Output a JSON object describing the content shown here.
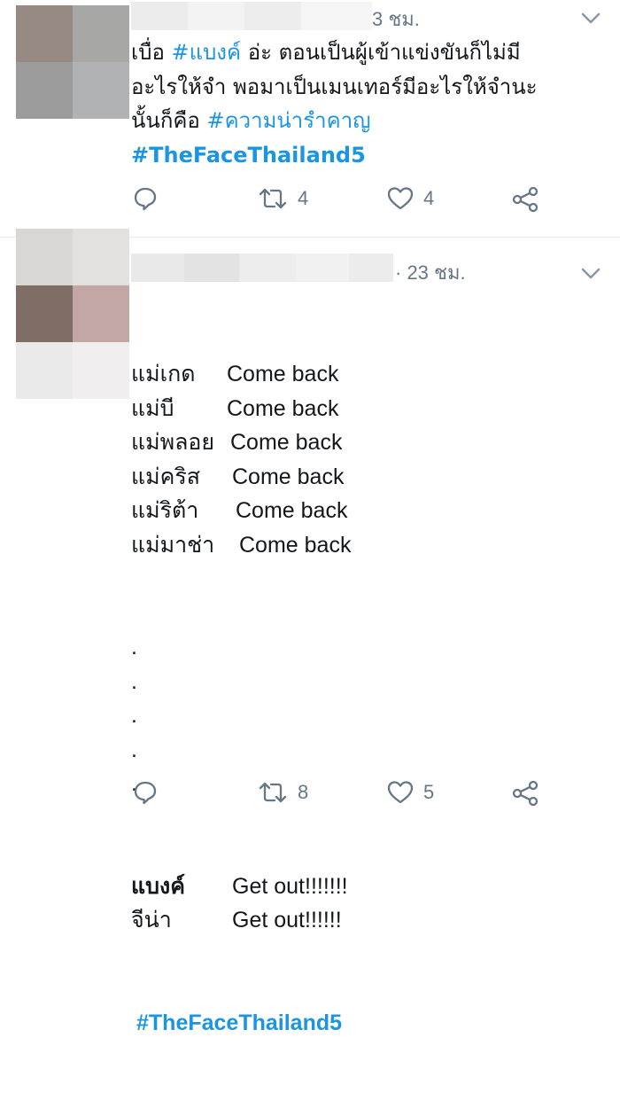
{
  "tweets": [
    {
      "time": "3 ชม.",
      "lines": [
        [
          {
            "t": "เบื่อ "
          },
          {
            "t": "#แบงค์",
            "tag": true
          },
          {
            "t": " อ่ะ ตอนเป็นผู้เข้าแข่งขันก็ไม่มี"
          }
        ],
        [
          {
            "t": "อะไรให้จำ พอมาเป็นเมนเทอร์มีอะไรให้จำนะ"
          }
        ],
        [
          {
            "t": "นั้นก็คือ "
          },
          {
            "t": "#ความน่ารำคาญ",
            "tag": true
          }
        ],
        [
          {
            "t": "#TheFaceThailand5",
            "tag": true,
            "bold": true
          }
        ]
      ],
      "actions": {
        "reply_icon": "reply-icon",
        "retweet_count": "4",
        "like_count": "4",
        "share_icon": "share-icon"
      }
    },
    {
      "time": "· 23 ชม.",
      "rows": [
        {
          "name": "แม่เกด",
          "phrase": "Come back"
        },
        {
          "name": "แม่บี",
          "phrase": "Come back"
        },
        {
          "name": "แม่พลอย",
          "phrase": "Come back"
        },
        {
          "name": "แม่คริส",
          "phrase": "Come back"
        },
        {
          "name": "แม่ริต้า",
          "phrase": "Come back"
        },
        {
          "name": "แม่มาช่า",
          "phrase": "Come back"
        }
      ],
      "dots": [
        ".",
        ".",
        ".",
        ".",
        "."
      ],
      "rows_end": [
        {
          "name": "แบงค์",
          "phrase": "Get out!!!!!!!"
        },
        {
          "name": "จีน่า",
          "phrase": "Get out!!!!!!"
        }
      ],
      "hashtag": "#TheFaceThailand5",
      "actions": {
        "retweet_count": "8",
        "like_count": "5"
      }
    }
  ],
  "colors": {
    "hashtag": "#1b95e0",
    "meta": "#657786",
    "divider": "#e6ecf0"
  }
}
